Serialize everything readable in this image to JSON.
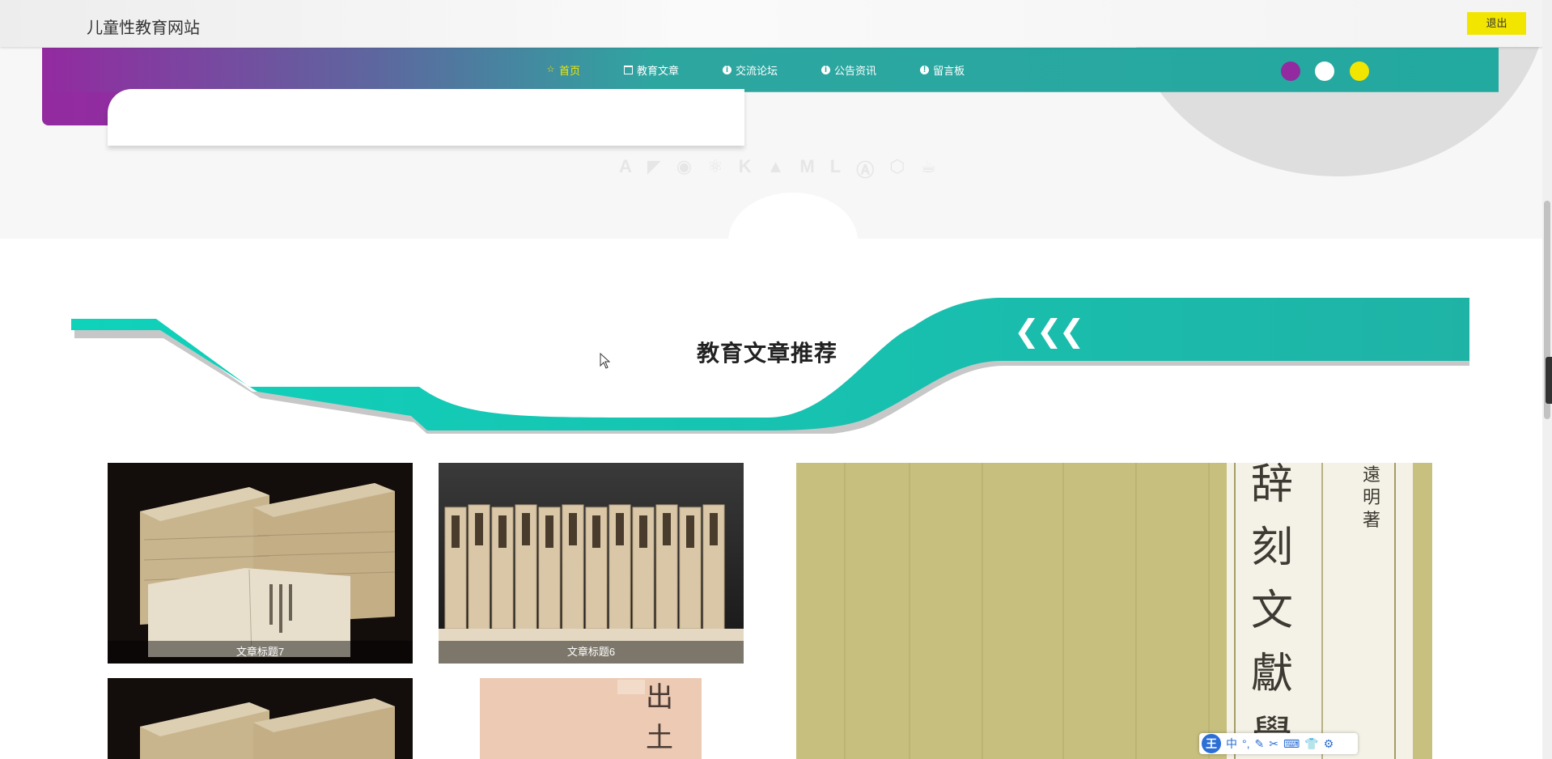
{
  "header": {
    "site_title": "儿童性教育网站",
    "logout_label": "退出"
  },
  "nav": {
    "items": [
      {
        "label": "首页",
        "icon": "star-icon",
        "active": true
      },
      {
        "label": "教育文章",
        "icon": "home-icon",
        "active": false
      },
      {
        "label": "交流论坛",
        "icon": "info-icon",
        "active": false
      },
      {
        "label": "公告资讯",
        "icon": "info-icon",
        "active": false
      },
      {
        "label": "留言板",
        "icon": "info-icon",
        "active": false
      }
    ],
    "theme_colors": [
      "#932aa0",
      "#ffffff",
      "#f2e600"
    ]
  },
  "tech_logos": [
    "angular-icon",
    "swift-icon",
    "android-icon",
    "react-icon",
    "kotlin-icon",
    "firebase-icon",
    "magento-icon",
    "laravel-icon",
    "appstore-icon",
    "css3-icon",
    "java-icon"
  ],
  "section": {
    "title": "教育文章推荐"
  },
  "articles": [
    {
      "caption": "文章标题7",
      "thumb": "stacked-books"
    },
    {
      "caption": "文章标题6",
      "thumb": "book-spines"
    },
    {
      "caption": "",
      "thumb": "stacked-books"
    },
    {
      "caption": "",
      "thumb": "pink-cover"
    }
  ],
  "featured": {
    "vertical_text_large": "辞刻文獻學",
    "vertical_text_small": "遠明 著"
  },
  "colors": {
    "teal": "#1fc4b0",
    "purple": "#932aa0",
    "yellow": "#f2e600"
  }
}
